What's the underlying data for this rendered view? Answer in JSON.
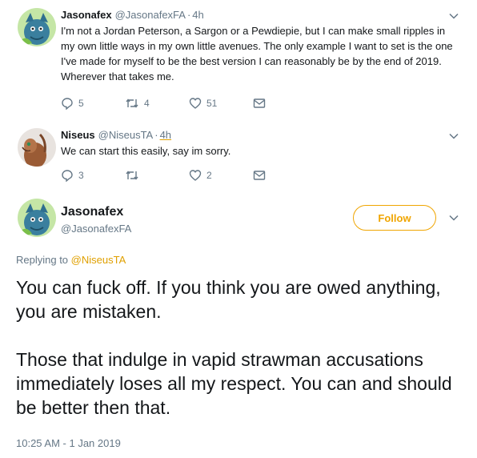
{
  "tweets": [
    {
      "name": "Jasonafex",
      "handle": "@JasonafexFA",
      "separator": "·",
      "time": "4h",
      "text": "I'm not a Jordan Peterson, a Sargon or a Pewdiepie, but I can make small ripples in my own little ways in my own little avenues. The only example I want to set is the one I've made for myself to be the best version I can reasonably be by the end of 2019. Wherever that takes me.",
      "replies": "5",
      "retweets": "4",
      "likes": "51"
    },
    {
      "name": "Niseus",
      "handle": "@NiseusTA",
      "separator": "·",
      "time": "4h",
      "text": "We can start this easily, say im sorry.",
      "replies": "3",
      "retweets": "",
      "likes": "2"
    }
  ],
  "main": {
    "name": "Jasonafex",
    "handle": "@JasonafexFA",
    "follow_label": "Follow",
    "replying_prefix": "Replying to",
    "replying_to": "@NiseusTA",
    "paragraph1": "You can fuck off. If you think you are owed anything, you are mistaken.",
    "paragraph2": "Those that indulge in vapid strawman accusations immediately loses all my respect. You can and should be better then that.",
    "timestamp": "10:25 AM - 1 Jan 2019"
  },
  "colors": {
    "accent": "#f0a500",
    "muted": "#657786",
    "text": "#14171a",
    "avatar_dragon": "#2f6f8f",
    "avatar_bg": "#c5e6a6"
  },
  "icons": [
    "reply-icon",
    "retweet-icon",
    "like-icon",
    "dm-icon",
    "chevron-down-icon"
  ]
}
